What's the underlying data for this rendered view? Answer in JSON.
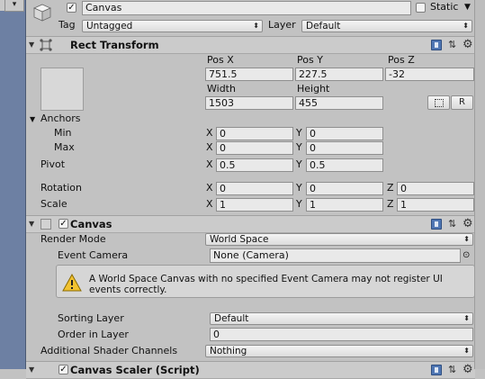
{
  "gameobject": {
    "active": true,
    "name": "Canvas",
    "static_label": "Static",
    "static_checked": false,
    "tag_label": "Tag",
    "tag_value": "Untagged",
    "layer_label": "Layer",
    "layer_value": "Default"
  },
  "rect_transform": {
    "title": "Rect Transform",
    "pos_x_label": "Pos X",
    "pos_y_label": "Pos Y",
    "pos_z_label": "Pos Z",
    "pos_x": "751.5",
    "pos_y": "227.5",
    "pos_z": "-32",
    "width_label": "Width",
    "height_label": "Height",
    "width": "1503",
    "height": "455",
    "raw_edit_button": "R",
    "anchors_label": "Anchors",
    "min_label": "Min",
    "max_label": "Max",
    "pivot_label": "Pivot",
    "rotation_label": "Rotation",
    "scale_label": "Scale",
    "x_label": "X",
    "y_label": "Y",
    "z_label": "Z",
    "anchor_min_x": "0",
    "anchor_min_y": "0",
    "anchor_max_x": "0",
    "anchor_max_y": "0",
    "pivot_x": "0.5",
    "pivot_y": "0.5",
    "rotation_x": "0",
    "rotation_y": "0",
    "rotation_z": "0",
    "scale_x": "1",
    "scale_y": "1",
    "scale_z": "1"
  },
  "canvas": {
    "title": "Canvas",
    "enabled": true,
    "render_mode_label": "Render Mode",
    "render_mode_value": "World Space",
    "event_camera_label": "Event Camera",
    "event_camera_value": "None (Camera)",
    "warning_text": "A World Space Canvas with no specified Event Camera may not register UI events correctly.",
    "sorting_layer_label": "Sorting Layer",
    "sorting_layer_value": "Default",
    "order_in_layer_label": "Order in Layer",
    "order_in_layer_value": "0",
    "shader_channels_label": "Additional Shader Channels",
    "shader_channels_value": "Nothing"
  },
  "next_component": {
    "title": "Canvas Scaler (Script)"
  },
  "colors": {
    "panel_bg": "#c2c2c2",
    "header_bg": "#cbcbcb",
    "left_strip": "#6d80a3"
  }
}
